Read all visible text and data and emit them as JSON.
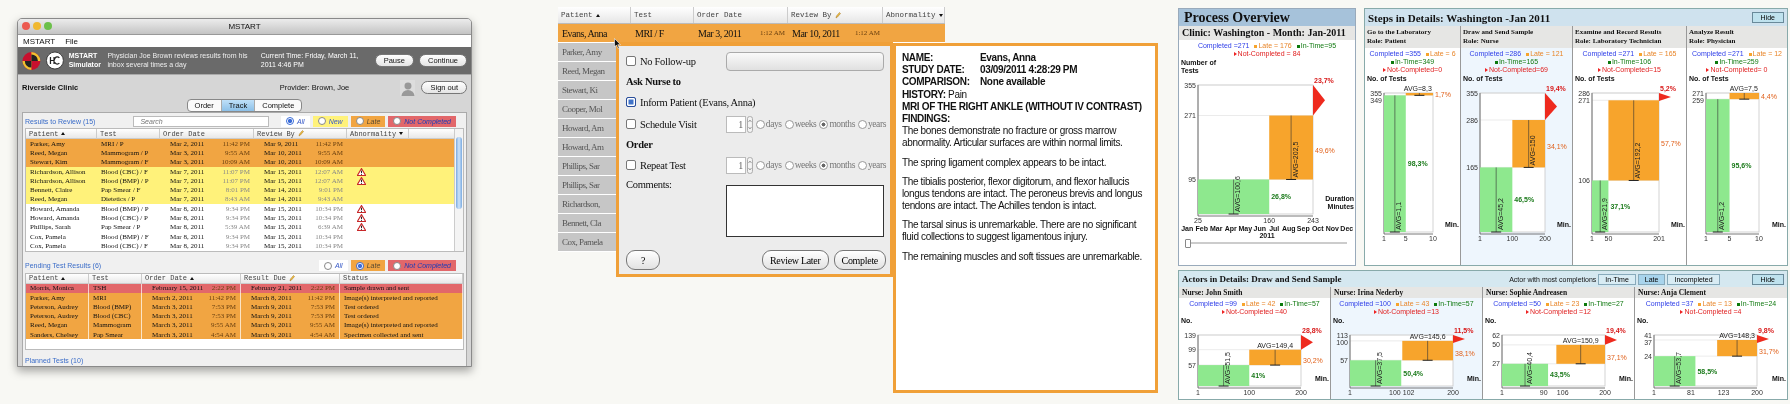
{
  "mstart_window": {
    "title": "MSTART",
    "menu": [
      "MSTART",
      "File"
    ],
    "app_name": "MSTART Simulator",
    "scenario": "Physician Joe Brown reviews results from his inbox several times a day",
    "current_time": "Current Time: Friday, March 11, 2011 4:46 PM",
    "buttons": [
      "Pause",
      "Continue"
    ],
    "clinic": "Riverside Clinic",
    "provider": "Provider: Brown, Joe",
    "sign_out": "Sign out",
    "tabs": [
      {
        "label": "Order",
        "selected": false
      },
      {
        "label": "Track",
        "selected": true
      },
      {
        "label": "Complete",
        "selected": false
      }
    ],
    "results": {
      "title": "Results to Review (15)",
      "search": {
        "placeholder": "Search"
      },
      "filters": [
        {
          "label": "All",
          "kind": "all",
          "selected": true
        },
        {
          "label": "New",
          "kind": "new",
          "selected": false
        },
        {
          "label": "Late",
          "kind": "late",
          "selected": false
        },
        {
          "label": "Not Completed",
          "kind": "not_completed",
          "selected": false
        }
      ],
      "columns": [
        {
          "label": "Patient",
          "sort_ascending": true
        },
        {
          "label": "Test"
        },
        {
          "label": "Order Date"
        },
        {
          "label": "Review By",
          "editable": true
        },
        {
          "label": "Abnormality",
          "sort_descending": true
        }
      ],
      "rows": [
        {
          "kind": "late",
          "patient": "Parker, Amy",
          "test": "MRI / P",
          "date_1": "Mar 2, 2011",
          "time_1": "11:42 PM",
          "date_2": "Mar 9, 2011",
          "time_2": "11:42 PM",
          "abnormal": false
        },
        {
          "kind": "late",
          "patient": "Reed, Megan",
          "test": "Mammogram / P",
          "date_1": "Mar 3, 2011",
          "time_1": "9:55 AM",
          "date_2": "Mar 10, 2011",
          "time_2": "9:55 AM",
          "abnormal": false
        },
        {
          "kind": "late",
          "patient": "Stewart, Kim",
          "test": "Mammogram / F",
          "date_1": "Mar 3, 2011",
          "time_1": "10:09 AM",
          "date_2": "Mar 10, 2011",
          "time_2": "10:09 AM",
          "abnormal": false
        },
        {
          "kind": "new",
          "patient": "Richardson, Allison",
          "test": "Blood (CBC) / F",
          "date_1": "Mar 7, 2011",
          "time_1": "11:07 PM",
          "date_2": "Mar 15, 2011",
          "time_2": "12:07 AM",
          "abnormal": true
        },
        {
          "kind": "new",
          "patient": "Richardson, Allison",
          "test": "Blood (BMP) / P",
          "date_1": "Mar 7, 2011",
          "time_1": "11:07 PM",
          "date_2": "Mar 15, 2011",
          "time_2": "12:07 AM",
          "abnormal": true
        },
        {
          "kind": "new",
          "patient": "Bennett, Claire",
          "test": "Pap Smear / F",
          "date_1": "Mar 7, 2011",
          "time_1": "8:01 PM",
          "date_2": "Mar 14, 2011",
          "time_2": "9:01 PM",
          "abnormal": false
        },
        {
          "kind": "new",
          "patient": "Reed, Megan",
          "test": "Dietetics / P",
          "date_1": "Mar 7, 2011",
          "time_1": "8:43 AM",
          "date_2": "Mar 14, 2011",
          "time_2": "9:43 AM",
          "abnormal": false
        },
        {
          "kind": "none",
          "patient": "Howard, Amanda",
          "test": "Blood (BMP) / P",
          "date_1": "Mar 8, 2011",
          "time_1": "9:34 PM",
          "date_2": "Mar 15, 2011",
          "time_2": "10:34 PM",
          "abnormal": true
        },
        {
          "kind": "none",
          "patient": "Howard, Amanda",
          "test": "Blood (CBC) / P",
          "date_1": "Mar 8, 2011",
          "time_1": "9:34 PM",
          "date_2": "Mar 15, 2011",
          "time_2": "10:34 PM",
          "abnormal": true
        },
        {
          "kind": "none",
          "patient": "Phillips, Sarah",
          "test": "Pap Smear / P",
          "date_1": "Mar 8, 2011",
          "time_1": "5:39 AM",
          "date_2": "Mar 15, 2011",
          "time_2": "6:39 AM",
          "abnormal": true
        },
        {
          "kind": "none",
          "patient": "Cox, Pamela",
          "test": "Blood (BMP) / F",
          "date_1": "Mar 8, 2011",
          "time_1": "9:34 PM",
          "date_2": "Mar 15, 2011",
          "time_2": "10:34 PM",
          "abnormal": false
        },
        {
          "kind": "none",
          "patient": "Cox, Pamela",
          "test": "Blood (CBC) / F",
          "date_1": "Mar 8, 2011",
          "time_1": "9:34 PM",
          "date_2": "Mar 15, 2011",
          "time_2": "10:34 PM",
          "abnormal": false
        }
      ]
    },
    "pending": {
      "title": "Pending Test Results (6)",
      "filters": [
        {
          "label": "All",
          "kind": "all",
          "selected": false
        },
        {
          "label": "Late",
          "kind": "late",
          "selected": true
        },
        {
          "label": "Not Completed",
          "kind": "not_completed",
          "selected": false
        }
      ],
      "columns": [
        {
          "label": "Patient",
          "sort_ascending": true
        },
        {
          "label": "Test"
        },
        {
          "label": "Order Date",
          "sort_ascending": true
        },
        {
          "label": "Result Due",
          "editable": true
        },
        {
          "label": "Status"
        }
      ],
      "rows": [
        {
          "kind": "not_completed",
          "patient": "Morris, Monica",
          "test": "TSH",
          "date_1": "February 15, 2011",
          "time_1": "2:22 PM",
          "date_2": "February 21, 2011",
          "time_2": "2:22 PM",
          "status": "Sample drawn and sent"
        },
        {
          "kind": "late",
          "patient": "Parker, Amy",
          "test": "MRI",
          "date_1": "March 2, 2011",
          "time_1": "11:42 PM",
          "date_2": "March 8, 2011",
          "time_2": "11:42 PM",
          "status": "Image(s) interpreted and reported"
        },
        {
          "kind": "late",
          "patient": "Peterson, Audrey",
          "test": "Blood (BMP)",
          "date_1": "March 3, 2011",
          "time_1": "7:53 PM",
          "date_2": "March 9, 2011",
          "time_2": "7:53 PM",
          "status": "Test ordered"
        },
        {
          "kind": "late",
          "patient": "Peterson, Audrey",
          "test": "Blood (CBC)",
          "date_1": "March 3, 2011",
          "time_1": "7:53 PM",
          "date_2": "March 9, 2011",
          "time_2": "7:53 PM",
          "status": "Test ordered"
        },
        {
          "kind": "late",
          "patient": "Reed, Megan",
          "test": "Mammogram",
          "date_1": "March 3, 2011",
          "time_1": "9:55 AM",
          "date_2": "March 9, 2011",
          "time_2": "9:55 AM",
          "status": "Image(s) interpreted and reported"
        },
        {
          "kind": "late",
          "patient": "Sanders, Chelsey",
          "test": "Pap Smear",
          "date_1": "March 3, 2011",
          "time_1": "4:54 AM",
          "date_2": "March 9, 2011",
          "time_2": "4:54 AM",
          "status": "Specimen collected and sent"
        }
      ]
    },
    "planned": {
      "title": "Planned Tests (10)"
    }
  },
  "review_screen": {
    "columns": [
      {
        "label": "Patient",
        "sort_ascending": true
      },
      {
        "label": "Test"
      },
      {
        "label": "Order Date"
      },
      {
        "label": "Review By",
        "editable": true
      },
      {
        "label": "Abnormality",
        "sort_descending": true
      }
    ],
    "rows": [
      {
        "patient": "Evans, Anna",
        "test": "MRI / F",
        "date_1": "Mar 3, 2011",
        "time_1": "1:12 AM",
        "date_2": "Mar 10, 2011",
        "time_2": "1:12 AM",
        "selected": true
      },
      {
        "patient": "Parker, Amy",
        "selected": false
      },
      {
        "patient": "Reed, Megan",
        "selected": false
      },
      {
        "patient": "Stewart, Ki",
        "selected": false
      },
      {
        "patient": "Cooper, Mol",
        "selected": false
      },
      {
        "patient": "Howard, Am",
        "selected": false
      },
      {
        "patient": "Howard, Am",
        "selected": false
      },
      {
        "patient": "Phillips, Sar",
        "selected": false
      },
      {
        "patient": "Phillips, Sar",
        "selected": false
      },
      {
        "patient": "Richardson,",
        "selected": false
      },
      {
        "patient": "Bennett, Cla",
        "selected": false
      },
      {
        "patient": "Cox, Pamela",
        "selected": false
      }
    ],
    "follow_up_form": {
      "items": [
        {
          "kind": "checkbox_select",
          "label": "No Follow-up",
          "checked": false
        },
        {
          "kind": "heading",
          "label": "Ask Nurse to"
        },
        {
          "kind": "checkbox",
          "label": "Inform Patient (Evans, Anna)",
          "checked": true
        },
        {
          "kind": "checkbox_interval",
          "label": "Schedule Visit",
          "checked": false,
          "count": "1",
          "units": [
            {
              "label": "days",
              "selected": false
            },
            {
              "label": "weeks",
              "selected": false
            },
            {
              "label": "months",
              "selected": true
            },
            {
              "label": "years",
              "selected": false
            }
          ]
        },
        {
          "kind": "heading",
          "label": "Order"
        },
        {
          "kind": "checkbox_interval",
          "label": "Repeat Test",
          "checked": false,
          "count": "1",
          "units": [
            {
              "label": "days",
              "selected": false
            },
            {
              "label": "weeks",
              "selected": false
            },
            {
              "label": "months",
              "selected": true
            },
            {
              "label": "years",
              "selected": false
            }
          ]
        },
        {
          "kind": "comments",
          "label": "Comments:"
        }
      ],
      "buttons": [
        {
          "label": "?",
          "kind": "help"
        },
        {
          "label": "Review Later",
          "kind": "action"
        },
        {
          "label": "Complete",
          "kind": "action"
        }
      ]
    },
    "report": {
      "fields": [
        {
          "label": "NAME:",
          "value": "Evans, Anna"
        },
        {
          "label": "STUDY DATE:",
          "value": "03/09/2011  4:28:29 PM"
        },
        {
          "label": "COMPARISON:",
          "value": "None available"
        }
      ],
      "history": "**HISTORY:** Pain",
      "exam": "MRI OF THE RIGHT ANKLE (WITHOUT IV CONTRAST)",
      "findings_heading": "FINDINGS:",
      "paragraphs": [
        "The bones demonstrate no fracture or gross marrow abnormality. Articular surfaces are within normal limits.",
        "The spring ligament complex appears to be intact.",
        "The tibialis posterior, flexor digitorum, and flexor hallucis longus tendons are intact.  The peroneus brevis and longus tendons are intact.  The Achilles tendon is intact.",
        "The tarsal sinus is unremarkable.  There are no significant fluid collections to suggest ligamentous injury.",
        "The remaining muscles and soft tissues are unremarkable."
      ]
    }
  },
  "process_dashboard": {
    "overview": {
      "title": "Process Overview",
      "subtitle": "Clinic: Washington - Month:  Jan-2011",
      "legend": [
        {
          "kind": "completed",
          "label": "Completed =271"
        },
        {
          "kind": "late",
          "label": "Late = 176"
        },
        {
          "kind": "in_time",
          "label": "In-Time=95"
        },
        {
          "kind": "not_completed",
          "label": "Not-Completed = 84"
        }
      ],
      "plot": {
        "y_title": "Number of Tests",
        "x_title": "Duration Minutes",
        "y_ticks": [
          "355",
          "271",
          "95"
        ],
        "x_ticks": [
          "25",
          "160",
          "243"
        ],
        "averages": [
          "AVG=100,6",
          "AVG=202,5"
        ],
        "shares": [
          "26,8%",
          "49,6%",
          "23,7%"
        ]
      },
      "months": [
        "Jan",
        "Feb",
        "Mar",
        "Apr",
        "May",
        "Jun",
        "Jul",
        "Aug",
        "Sep",
        "Oct",
        "Nov",
        "Dec"
      ],
      "year": "2011",
      "timeline_slider": {
        "level": 0
      }
    },
    "steps": {
      "title": "Steps in Details: Washington -Jan 2011",
      "hide": "Hide",
      "items": [
        {
          "title": "Go to the Laboratory",
          "role": "Role: Patient",
          "selected": false,
          "legend": [
            {
              "kind": "completed",
              "label": "Completed =355"
            },
            {
              "kind": "late",
              "label": "Late = 6"
            },
            {
              "kind": "in_time",
              "label": "In-Time=349"
            },
            {
              "kind": "not_completed",
              "label": "Not-Completed=0"
            }
          ],
          "plot": {
            "y_title": "No. of Tests",
            "x_title": "Min.",
            "y_ticks": [
              "355",
              "349"
            ],
            "x_ticks": [
              "1",
              "5",
              "10"
            ],
            "averages": [
              "AVG=1,1",
              "AVG=8,3"
            ],
            "shares": [
              "98,3%",
              "1,7%"
            ]
          }
        },
        {
          "title": "Draw and Send Sample",
          "role": "Role: Nurse",
          "selected": true,
          "legend": [
            {
              "kind": "completed",
              "label": "Completed =286"
            },
            {
              "kind": "late",
              "label": "Late = 121"
            },
            {
              "kind": "in_time",
              "label": "In-Time=165"
            },
            {
              "kind": "not_completed",
              "label": "Not-Completed=69"
            }
          ],
          "plot": {
            "y_title": "No. of Tests",
            "x_title": "Min.",
            "y_ticks": [
              "355",
              "286",
              "165"
            ],
            "x_ticks": [
              "1",
              "100",
              "200"
            ],
            "averages": [
              "AVG=45,2",
              "AVG=150"
            ],
            "shares": [
              "46,5%",
              "34,1%",
              "19,4%"
            ]
          }
        },
        {
          "title": "Examine and Record Results",
          "role": "Role: Laboratory Technician",
          "selected": false,
          "legend": [
            {
              "kind": "completed",
              "label": "Completed =271"
            },
            {
              "kind": "late",
              "label": "Late = 165"
            },
            {
              "kind": "in_time",
              "label": "In-Time=106"
            },
            {
              "kind": "not_completed",
              "label": "Not-Completed=15"
            }
          ],
          "plot": {
            "y_title": "No. of Tests",
            "x_title": "Min.",
            "y_ticks": [
              "286",
              "271",
              "106"
            ],
            "x_ticks": [
              "1",
              "50",
              "201"
            ],
            "averages": [
              "AVG=21,9",
              "AVG=192,2"
            ],
            "shares": [
              "37,1%",
              "57,7%",
              "5,2%"
            ]
          }
        },
        {
          "title": "Analyze Result",
          "role": "Role: Physician",
          "selected": false,
          "legend": [
            {
              "kind": "completed",
              "label": "Completed =271"
            },
            {
              "kind": "late",
              "label": "Late = 12"
            },
            {
              "kind": "in_time",
              "label": "In-Time=259"
            },
            {
              "kind": "not_completed",
              "label": "Not-Completed= 0"
            }
          ],
          "plot": {
            "y_title": "No. of Tests",
            "x_title": "Min.",
            "y_ticks": [
              "271",
              "259"
            ],
            "x_ticks": [
              "1",
              "5",
              "10"
            ],
            "averages": [
              "AVG=1,2",
              "AVG=7,5"
            ],
            "shares": [
              "95,6%",
              "4,4%"
            ]
          }
        }
      ]
    },
    "actors": {
      "title": "Actors in Details: Draw and Send Sample",
      "prompt": "Actor with most completions",
      "options": [
        {
          "label": "In-Time",
          "selected": false
        },
        {
          "label": "Late",
          "selected": true
        },
        {
          "label": "Incompleted",
          "selected": false
        }
      ],
      "hide": "Hide",
      "items": [
        {
          "title": "Nurse: John Smith",
          "selected": false,
          "legend": [
            {
              "kind": "completed",
              "label": "Completed =99"
            },
            {
              "kind": "late",
              "label": "Late = 42"
            },
            {
              "kind": "in_time",
              "label": "In-Time=57"
            },
            {
              "kind": "not_completed",
              "label": "Not-Completed =40"
            }
          ],
          "plot": {
            "y_title": "No.",
            "x_title": "Min.",
            "y_ticks": [
              "139",
              "99",
              "57"
            ],
            "x_ticks": [
              "1",
              "100",
              "200"
            ],
            "averages": [
              "AVG=51,5",
              "AVG=149,4"
            ],
            "shares": [
              "41%",
              "30,2%",
              "28,8%"
            ]
          }
        },
        {
          "title": "Nurse: Irina Nederby",
          "selected": true,
          "legend": [
            {
              "kind": "completed",
              "label": "Completed =100"
            },
            {
              "kind": "late",
              "label": "Late = 43"
            },
            {
              "kind": "in_time",
              "label": "In-Time=57"
            },
            {
              "kind": "not_completed",
              "label": "Not-Completed =13"
            }
          ],
          "plot": {
            "y_title": "No.",
            "x_title": "Min.",
            "y_ticks": [
              "113",
              "100",
              "57"
            ],
            "x_ticks": [
              "1",
              "100",
              "102",
              "200"
            ],
            "averages": [
              "AVG=37,5",
              "AVG=145,6"
            ],
            "shares": [
              "50,4%",
              "38,1%",
              "11,5%"
            ]
          }
        },
        {
          "title": "Nurse: Sophie Andreasen",
          "selected": false,
          "legend": [
            {
              "kind": "completed",
              "label": "Completed =50"
            },
            {
              "kind": "late",
              "label": "Late = 23"
            },
            {
              "kind": "in_time",
              "label": "In-Time=27"
            },
            {
              "kind": "not_completed",
              "label": "Not-Completed =12"
            }
          ],
          "plot": {
            "y_title": "No.",
            "x_title": "Min.",
            "y_ticks": [
              "62",
              "50",
              "27"
            ],
            "x_ticks": [
              "1",
              "90",
              "106",
              "200"
            ],
            "averages": [
              "AVG=40,4",
              "AVG=150,9"
            ],
            "shares": [
              "43,5%",
              "37,1%",
              "19,4%"
            ]
          }
        },
        {
          "title": "Nurse: Anja Clement",
          "selected": false,
          "legend": [
            {
              "kind": "completed",
              "label": "Completed =37"
            },
            {
              "kind": "late",
              "label": "Late = 13"
            },
            {
              "kind": "in_time",
              "label": "In-Time=24"
            },
            {
              "kind": "not_completed",
              "label": "Not-Completed =4"
            }
          ],
          "plot": {
            "y_title": "No.",
            "x_title": "Min.",
            "y_ticks": [
              "41",
              "37",
              "24"
            ],
            "x_ticks": [
              "1",
              "81",
              "123",
              "200"
            ],
            "averages": [
              "AVG=53,7",
              "AVG=148,3"
            ],
            "shares": [
              "58,5%",
              "31,7%",
              "9,8%"
            ]
          }
        }
      ]
    }
  }
}
